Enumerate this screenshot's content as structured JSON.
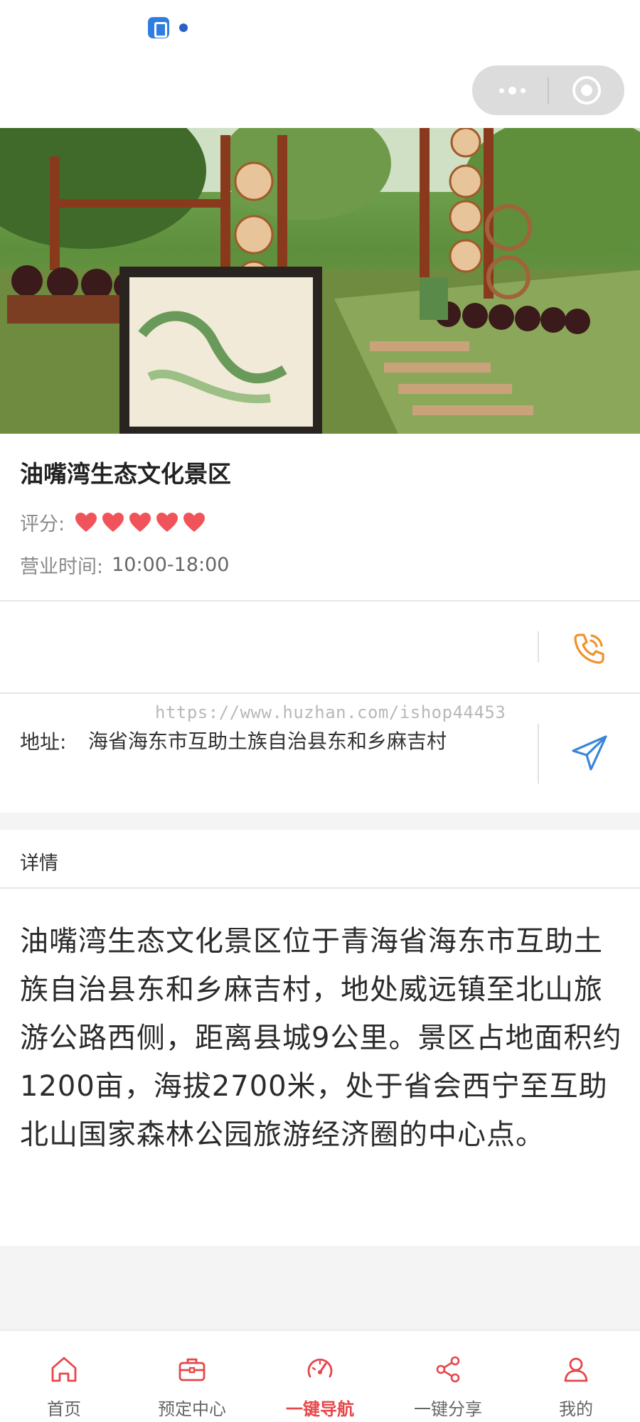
{
  "spot": {
    "title": "油嘴湾生态文化景区",
    "rating_label": "评分:",
    "rating_value": 5,
    "rating_max": 5,
    "hours_label": "营业时间:",
    "hours_value": "10:00-18:00"
  },
  "address": {
    "label": "地址:",
    "value": "海省海东市互助土族自治县东和乡麻吉村"
  },
  "watermark": "https://www.huzhan.com/ishop44453",
  "detail": {
    "heading": "详情",
    "body": "油嘴湾生态文化景区位于青海省海东市互助土族自治县东和乡麻吉村，地处威远镇至北山旅游公路西侧，距离县城9公里。景区占地面积约1200亩，海拔2700米，处于省会西宁至互助北山国家森林公园旅游经济圈的中心点。"
  },
  "banner": {
    "slide_count": 2,
    "active_slide": 1
  },
  "tabbar": [
    {
      "label": "首页",
      "icon": "home-icon"
    },
    {
      "label": "预定中心",
      "icon": "briefcase-icon"
    },
    {
      "label": "一键导航",
      "icon": "speedometer-icon",
      "active": true
    },
    {
      "label": "一键分享",
      "icon": "share-icon"
    },
    {
      "label": "我的",
      "icon": "user-icon"
    }
  ],
  "colors": {
    "accent": "#e5474a",
    "phone": "#f0922d",
    "navigate": "#3a86d8",
    "heart": "#f0545a"
  }
}
